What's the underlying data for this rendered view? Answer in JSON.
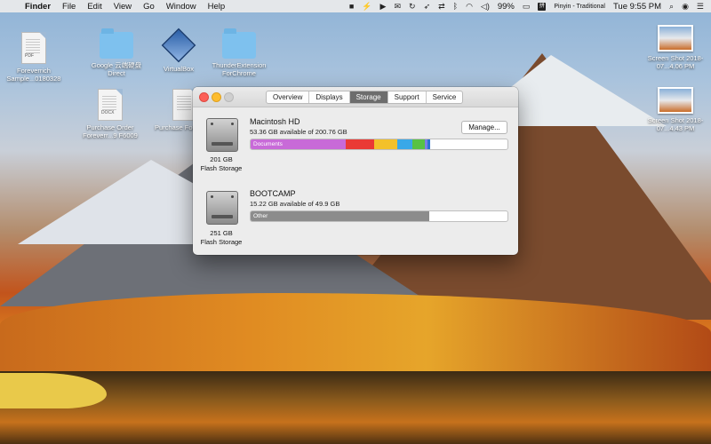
{
  "menubar": {
    "apple_icon": "apple-icon",
    "app_name": "Finder",
    "menus": [
      "File",
      "Edit",
      "View",
      "Go",
      "Window",
      "Help"
    ],
    "battery": "99%",
    "input_source": "Pinyin - Traditional",
    "clock": "Tue 9:55 PM"
  },
  "desktop": {
    "icons": [
      {
        "label": "Foreverrich Sample...0180328",
        "kind": "pdf-document",
        "tag": "PDF"
      },
      {
        "label": "Google 云端硬盘 Direct",
        "kind": "folder"
      },
      {
        "label": "VirtualBox",
        "kind": "app"
      },
      {
        "label": "ThunderExtension ForChrome",
        "kind": "folder"
      },
      {
        "label": "Purchase Order Foreverr...9 F6009",
        "kind": "docx-document",
        "tag": "DOCX"
      },
      {
        "label": "Purchase Foreverr...",
        "kind": "document",
        "tag": ""
      },
      {
        "label": "Screen Shot 2018-07...4.06 PM",
        "kind": "screenshot"
      },
      {
        "label": "Screen Shot 2018-07...4.43 PM",
        "kind": "screenshot"
      }
    ]
  },
  "window": {
    "tabs": [
      "Overview",
      "Displays",
      "Storage",
      "Support",
      "Service"
    ],
    "active_tab": "Storage",
    "disks": [
      {
        "name": "Macintosh HD",
        "available": "53.36 GB available of 200.76 GB",
        "capacity_line1": "201 GB",
        "capacity_line2": "Flash Storage",
        "manage_label": "Manage...",
        "segments": [
          {
            "label": "Documents",
            "color": "#c86ad8",
            "fraction": 0.37
          },
          {
            "label": "",
            "color": "#ea3a35",
            "fraction": 0.11
          },
          {
            "label": "",
            "color": "#f3c12a",
            "fraction": 0.09
          },
          {
            "label": "",
            "color": "#39a8e8",
            "fraction": 0.06
          },
          {
            "label": "",
            "color": "#58c244",
            "fraction": 0.05
          },
          {
            "label": "",
            "color": "#7a7fe6",
            "fraction": 0.01
          },
          {
            "label": "",
            "color": "#2a75d0",
            "fraction": 0.01
          }
        ]
      },
      {
        "name": "BOOTCAMP",
        "available": "15.22 GB available of 49.9 GB",
        "capacity_line1": "251 GB",
        "capacity_line2": "Flash Storage",
        "segments": [
          {
            "label": "Other",
            "color": "#8c8c8c",
            "fraction": 0.695
          }
        ]
      }
    ]
  }
}
